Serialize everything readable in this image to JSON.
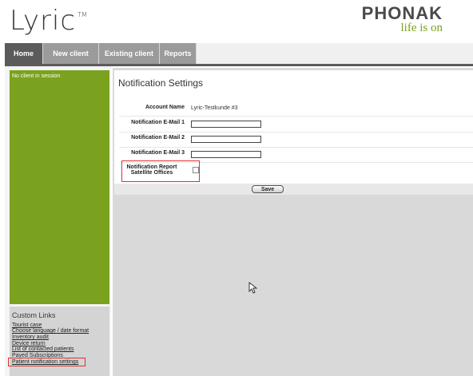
{
  "brand": {
    "product_name": "Lyric",
    "trademark": "TM",
    "company": "PHONAK",
    "tagline": "life is on"
  },
  "nav": {
    "tabs": [
      {
        "label": "Home",
        "active": true
      },
      {
        "label": "New client",
        "active": false
      },
      {
        "label": "Existing client",
        "active": false
      },
      {
        "label": "Reports",
        "active": false
      }
    ]
  },
  "sidebar": {
    "session_text": "No client in session",
    "custom_links_title": "Custom Links",
    "links": [
      "Tourist case",
      "Choose language / date format",
      "Inventory audit",
      "Device return",
      "List of contacted patients",
      "Payed Subscriptions",
      "Patient notification settings"
    ]
  },
  "page": {
    "title": "Notification Settings",
    "fields": {
      "account_name": {
        "label": "Account Name",
        "value": "Lyric-Testkunde #3"
      },
      "email1": {
        "label": "Notification E-Mail 1",
        "value": ""
      },
      "email2": {
        "label": "Notification E-Mail 2",
        "value": ""
      },
      "email3": {
        "label": "Notification E-Mail 3",
        "value": ""
      },
      "report": {
        "label_line1": "Notification Report",
        "label_line2": "Satellite Offices",
        "checked": false
      }
    },
    "save_label": "Save"
  },
  "colors": {
    "accent_green": "#7aa21e",
    "nav_active": "#5b5b5b",
    "nav_inactive": "#9b9b9b",
    "highlight_red": "#e03030"
  }
}
